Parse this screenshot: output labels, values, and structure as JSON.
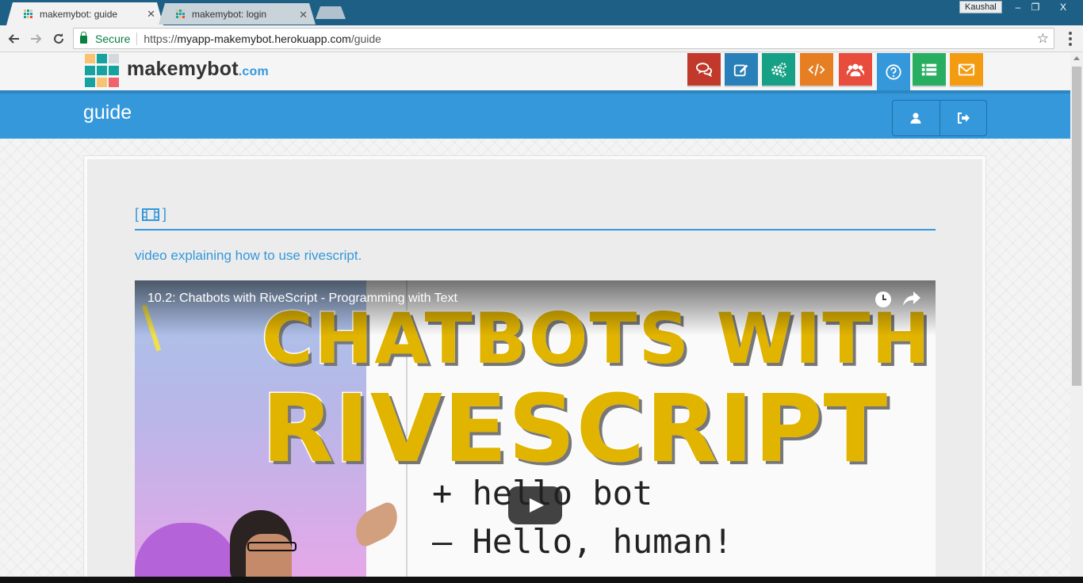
{
  "browser": {
    "tabs": [
      {
        "title": "makemybot: guide",
        "active": true
      },
      {
        "title": "makemybot: login",
        "active": false
      }
    ],
    "profile_name": "Kaushal",
    "window_controls": {
      "minimize": "–",
      "restore": "❐",
      "close": "X"
    },
    "secure_label": "Secure",
    "url_scheme": "https://",
    "url_host": "myapp-makemybot.herokuapp.com",
    "url_path": "/guide"
  },
  "header": {
    "brand_name": "makemybot",
    "brand_suffix": ".com",
    "nav_buttons": [
      {
        "icon": "comments-icon",
        "color": "#c0392b"
      },
      {
        "icon": "edit-icon",
        "color": "#2980b9"
      },
      {
        "icon": "cogs-icon",
        "color": "#16a085"
      },
      {
        "icon": "code-icon",
        "color": "#e67e22"
      },
      {
        "icon": "users-icon",
        "color": "#e74c3c"
      },
      {
        "icon": "help-icon",
        "color": "#3498db"
      },
      {
        "icon": "list-icon",
        "color": "#27ae60"
      },
      {
        "icon": "mail-icon",
        "color": "#f39c12"
      }
    ]
  },
  "page": {
    "title": "guide",
    "section_label_open": "[",
    "section_label_close": "]",
    "description": "video explaining how to use rivescript."
  },
  "video": {
    "title": "10.2: Chatbots with RiveScript - Programming with Text",
    "headline_line1": "CHATBOTS WITH",
    "headline_line2": "RIVESCRIPT",
    "code_line1": "+ hello bot",
    "code_line2": "– Hello, human!"
  },
  "colors": {
    "accent": "#3498db",
    "tabbar": "#1e5f86"
  }
}
